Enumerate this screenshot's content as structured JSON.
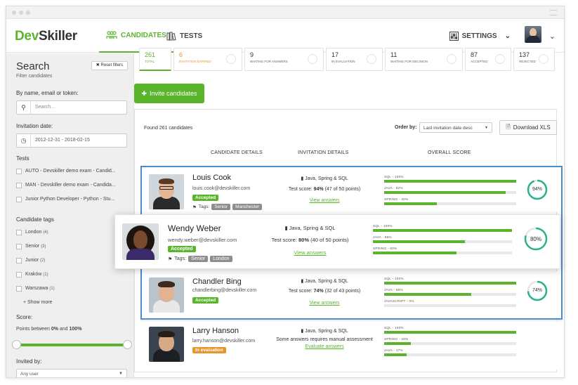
{
  "app": {
    "logo_dev": "Dev",
    "logo_skiller": "Skiller"
  },
  "nav": {
    "candidates": "CANDIDATES",
    "tests": "TESTS",
    "settings": "SETTINGS"
  },
  "sidebar": {
    "title": "Search",
    "subtitle": "Filter candidates",
    "reset": "Reset filters",
    "name_label": "By name, email or token:",
    "search_placeholder": "Search...",
    "date_label": "Invitation date:",
    "date_value": "2012-12-31 - 2018-02-15",
    "tests_label": "Tests",
    "tests": [
      "AUTO - Devskiller demo exam - Candid...",
      "MAN - Devskiller demo exam - Candida...",
      "Junior Python Developer - Python - Stu..."
    ],
    "tags_label": "Candidate tags",
    "tags": [
      {
        "name": "London",
        "count": "(4)"
      },
      {
        "name": "Senior",
        "count": "(3)"
      },
      {
        "name": "Junior",
        "count": "(2)"
      },
      {
        "name": "Kraków",
        "count": "(1)"
      },
      {
        "name": "Warszawa",
        "count": "(1)"
      }
    ],
    "show_more": "Show more",
    "score_label": "Score:",
    "score_text_pre": "Points between ",
    "score_min": "0%",
    "score_mid": " and ",
    "score_max": "100%",
    "invited_label": "Invited by:",
    "invited_value": "Any user"
  },
  "statuses": [
    {
      "num": "261",
      "label": "TOTAL"
    },
    {
      "num": "6",
      "label": "INVITATION EXPIRED"
    },
    {
      "num": "9",
      "label": "WAITING FOR ANSWERS"
    },
    {
      "num": "17",
      "label": "IN EVALUATION"
    },
    {
      "num": "11",
      "label": "WAITING FOR DECISION"
    },
    {
      "num": "87",
      "label": "ACCEPTED"
    },
    {
      "num": "137",
      "label": "REJECTED"
    }
  ],
  "main": {
    "invite": "Invite candidates",
    "found": "Found 261 candidates",
    "order_by": "Order by:",
    "order_value": "Last invitation date desc",
    "download": "Download XLS",
    "col_details": "CANDIDATE DETAILS",
    "col_invitation": "INVITATION DETAILS",
    "col_score": "OVERALL SCORE"
  },
  "tags_prefix": "Tags:",
  "candidates": [
    {
      "name": "Louis Cook",
      "email": "louis.cook@devskiller.com",
      "status": "Accepted",
      "tags": [
        "Senior",
        "Manchester"
      ],
      "test": "Java, Spring & SQL",
      "score_pre": "Test score: ",
      "score_pct": "94%",
      "score_post": " (47 of 50 points)",
      "link": "View answers",
      "skills": [
        {
          "label": "SQL - 100%",
          "value": 100
        },
        {
          "label": "JAVA - 92%",
          "value": 92
        },
        {
          "label": "SPRING - 40%",
          "value": 40
        }
      ],
      "overall": "94%",
      "overall_value": 94
    },
    {
      "name": "Wendy Weber",
      "email": "wendy.weber@devskiller.com",
      "status": "Accepted",
      "tags": [
        "Senior",
        "London"
      ],
      "test": "Java, Spring & SQL",
      "score_pre": "Test score: ",
      "score_pct": "80%",
      "score_post": " (40 of 50 points)",
      "link": "View answers",
      "skills": [
        {
          "label": "SQL - 100%",
          "value": 100
        },
        {
          "label": "JAVA - 66%",
          "value": 66
        },
        {
          "label": "SPRING - 60%",
          "value": 60
        }
      ],
      "overall": "80%",
      "overall_value": 80
    },
    {
      "name": "Chandler Bing",
      "email": "chandlerbing@devskiller.com",
      "status": "Accepted",
      "test": "Java, Spring & SQL",
      "score_pre": "Test score: ",
      "score_pct": "74%",
      "score_post": " (32 of 43 points)",
      "link": "View answers",
      "skills": [
        {
          "label": "SQL - 100%",
          "value": 100
        },
        {
          "label": "JAVA - 66%",
          "value": 66
        },
        {
          "label": "JAVASCRIPT - 0%",
          "value": 0
        }
      ],
      "overall": "74%",
      "overall_value": 74
    },
    {
      "name": "Larry Hanson",
      "email": "larry.hanson@devskiller.com",
      "status": "In evaluation",
      "test": "Java, Spring & SQL",
      "note": "Some answers requires manual assessment",
      "link": "Evaluate answers",
      "skills": [
        {
          "label": "SQL - 100%",
          "value": 100
        },
        {
          "label": "SPRING - 20%",
          "value": 20
        },
        {
          "label": "JAVA - 17%",
          "value": 17
        }
      ]
    }
  ],
  "colors": {
    "accent": "#5ab52c",
    "orange": "#e8952d",
    "teal": "#2bb28f",
    "blue": "#4a8bc9"
  }
}
